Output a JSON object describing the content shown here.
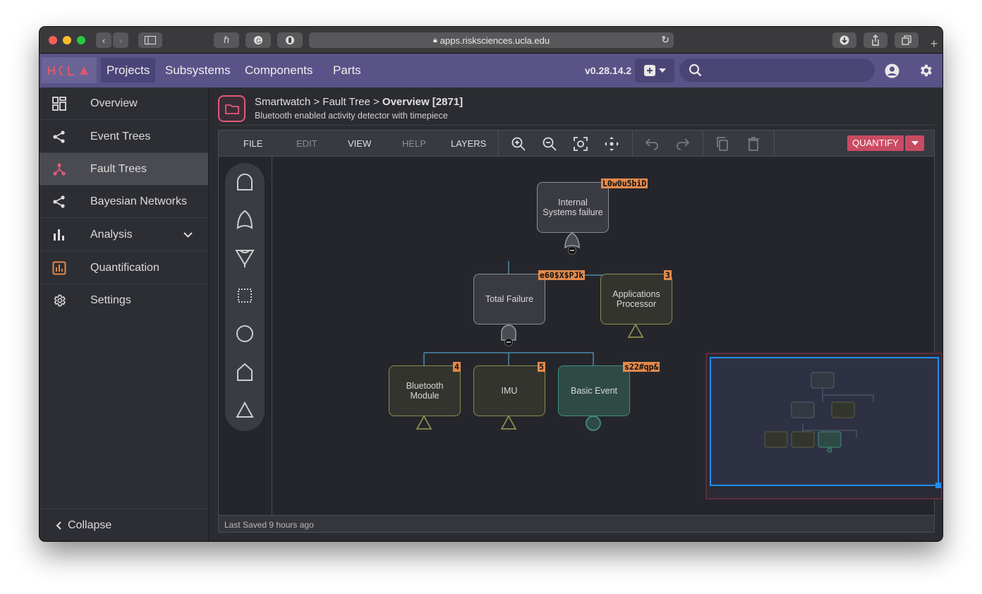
{
  "browser": {
    "url": "apps.risksciences.ucla.edu"
  },
  "app": {
    "logo": "UCLA",
    "nav": [
      "Projects",
      "Subsystems",
      "Components",
      "Parts"
    ],
    "active_nav": "Projects",
    "version": "v0.28.14.2",
    "search_placeholder": ""
  },
  "sidebar": {
    "items": [
      {
        "label": "Overview",
        "icon": "grid-icon"
      },
      {
        "label": "Event Trees",
        "icon": "share-icon"
      },
      {
        "label": "Fault Trees",
        "icon": "fault-tree-icon"
      },
      {
        "label": "Bayesian Networks",
        "icon": "share-icon"
      },
      {
        "label": "Analysis",
        "icon": "bar-chart-icon"
      },
      {
        "label": "Quantification",
        "icon": "quantification-icon"
      },
      {
        "label": "Settings",
        "icon": "gear-icon"
      }
    ],
    "active": "Fault Trees",
    "collapse_label": "Collapse"
  },
  "header": {
    "breadcrumb_prefix": "Smartwatch > Fault Tree > ",
    "breadcrumb_current": "Overview [2871]",
    "subtitle": "Bluetooth enabled activity detector with timepiece"
  },
  "toolbar": {
    "menus": [
      "FILE",
      "EDIT",
      "VIEW",
      "HELP",
      "LAYERS"
    ],
    "disabled_menus": [
      "EDIT",
      "HELP"
    ],
    "quantify_label": "QUANTIFY"
  },
  "tree": {
    "nodes": [
      {
        "label": "Internal Systems failure",
        "tag": "L0w0u5biD",
        "kind": "gate"
      },
      {
        "label": "Total Failure",
        "tag": "e60$X$PJk",
        "kind": "gate"
      },
      {
        "label": "Applications Processor",
        "tag": "3",
        "kind": "undeveloped"
      },
      {
        "label": "Bluetooth Module",
        "tag": "4",
        "kind": "undeveloped"
      },
      {
        "label": "IMU",
        "tag": "5",
        "kind": "undeveloped"
      },
      {
        "label": "Basic Event",
        "tag": "s22#qp&",
        "kind": "basic"
      }
    ]
  },
  "status": {
    "last_saved": "Last Saved 9 hours ago"
  },
  "colors": {
    "appbar": "#5a5388",
    "accent": "#e05a77",
    "quantify": "#c94b62",
    "tag": "#e28a4c",
    "minimap_viewport": "#1f8ef1"
  }
}
